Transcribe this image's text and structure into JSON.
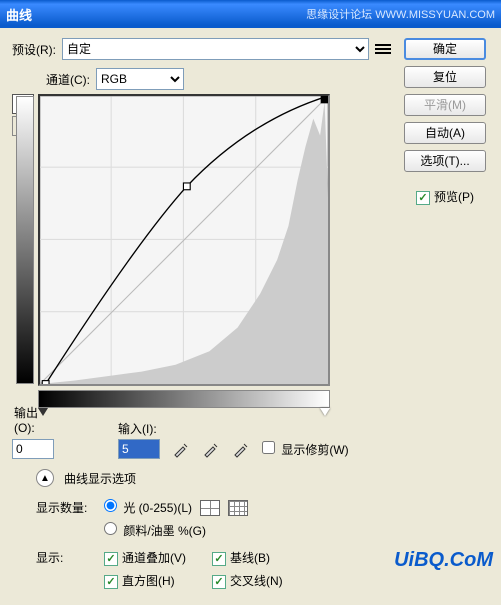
{
  "titlebar": {
    "title": "曲线",
    "credit": "思缘设计论坛 WWW.MISSYUAN.COM"
  },
  "preset": {
    "label": "预设(R):",
    "value": "自定"
  },
  "channel": {
    "label": "通道(C):",
    "value": "RGB"
  },
  "output": {
    "label": "输出(O):",
    "value": "0"
  },
  "input": {
    "label": "输入(I):",
    "value": "5"
  },
  "show_clipping": "显示修剪(W)",
  "curve_display_options": "曲线显示选项",
  "display": {
    "amount_label": "显示数量:",
    "light": "光 (0-255)(L)",
    "pigment": "颜料/油墨 %(G)",
    "show_label": "显示:",
    "overlay": "通道叠加(V)",
    "baseline": "基线(B)",
    "histogram": "直方图(H)",
    "intersection": "交叉线(N)"
  },
  "buttons": {
    "ok": "确定",
    "cancel": "复位",
    "smooth": "平滑(M)",
    "auto": "自动(A)",
    "options": "选项(T)..."
  },
  "preview": "预览(P)",
  "chart_data": {
    "type": "curve",
    "xlim": [
      0,
      255
    ],
    "ylim": [
      0,
      255
    ],
    "points": [
      {
        "x": 5,
        "y": 0
      },
      {
        "x": 130,
        "y": 175
      },
      {
        "x": 255,
        "y": 255
      }
    ],
    "histogram_hint": "right-skewed, peak near 230-250"
  },
  "brand": "UiBQ.CoM"
}
